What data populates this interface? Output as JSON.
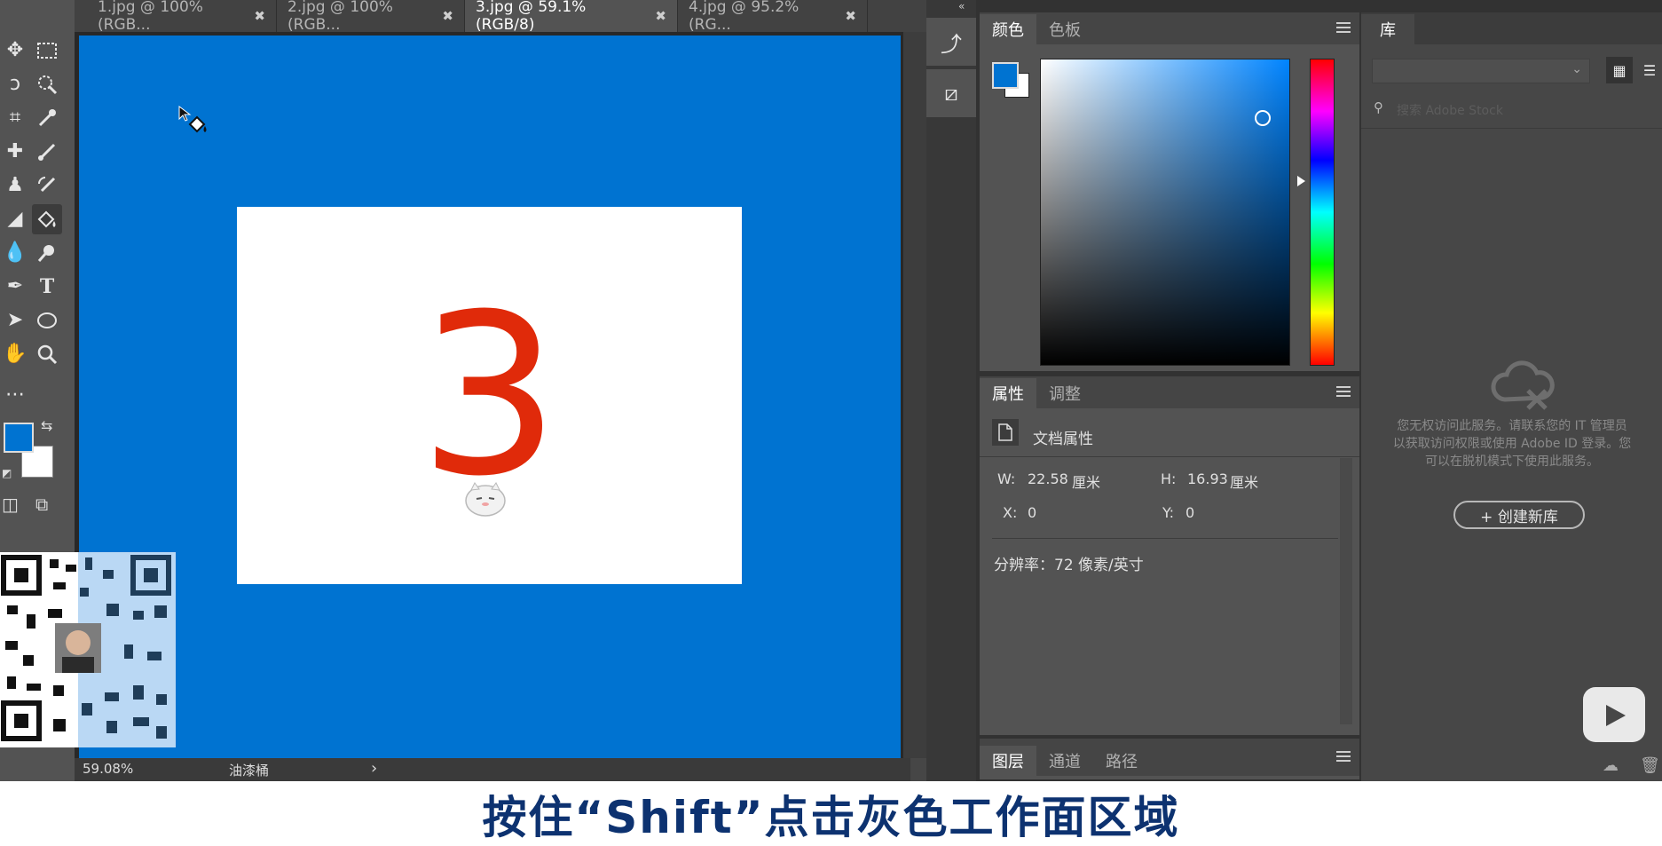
{
  "tabs": [
    {
      "label": "1.jpg @ 100%(RGB..."
    },
    {
      "label": "2.jpg @ 100%(RGB..."
    },
    {
      "label": "3.jpg @ 59.1%(RGB/8)"
    },
    {
      "label": "4.jpg @ 95.2%(RG..."
    }
  ],
  "canvas": {
    "number": "3"
  },
  "statusbar": {
    "zoom": "59.08%",
    "tool_name": "油漆桶",
    "arrow": "›"
  },
  "color_panel": {
    "tabs": [
      "颜色",
      "色板"
    ],
    "fg_color": "#0073d1",
    "bg_color": "#ffffff"
  },
  "properties_panel": {
    "tabs": [
      "属性",
      "调整"
    ],
    "doc_title": "文档属性",
    "w_label": "W:",
    "w_value": "22.58",
    "w_unit": "厘米",
    "h_label": "H:",
    "h_value": "16.93",
    "h_unit": "厘米",
    "x_label": "X:",
    "x_value": "0",
    "y_label": "Y:",
    "y_value": "0",
    "resolution": "分辨率：72 像素/英寸"
  },
  "layers_panel": {
    "tabs": [
      "图层",
      "通道",
      "路径"
    ]
  },
  "library_panel": {
    "tab": "库",
    "search_placeholder": "搜索 Adobe Stock",
    "message": "您无权访问此服务。请联系您的 IT 管理员以获取访问权限或使用 Adobe ID 登录。您可以在脱机模式下使用此服务。",
    "create_button": "+ 创建新库"
  },
  "subtitle": "按住“Shift”点击灰色工作面区域",
  "colors": {
    "accent_blue": "#0073d1",
    "digit_red": "#e02a0a",
    "subtitle_blue": "#0d3270"
  }
}
